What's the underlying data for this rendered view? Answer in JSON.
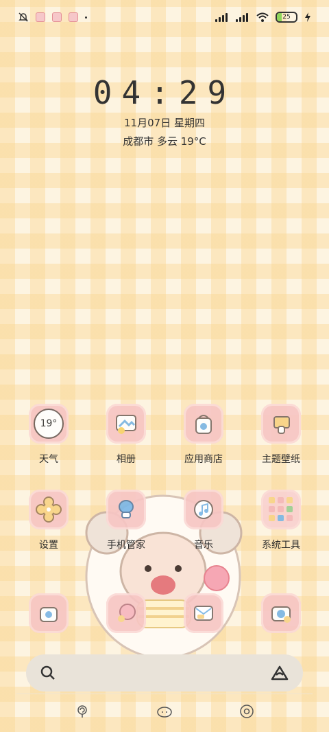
{
  "status": {
    "battery": "25",
    "battery_level_percent": 25,
    "icons": [
      "bell-off-icon",
      "notification-icon-1",
      "notification-icon-2",
      "notification-icon-3",
      "dot-icon",
      "signal-icon-1",
      "signal-icon-2",
      "wifi-icon",
      "battery-icon",
      "charging-icon"
    ]
  },
  "clock": {
    "time": "04:29",
    "date": "11月07日 星期四",
    "weather": "成都市 多云 19°C"
  },
  "apps": {
    "weather": {
      "label": "天气",
      "icon_text": "19°"
    },
    "album": {
      "label": "相册"
    },
    "store": {
      "label": "应用商店"
    },
    "themes": {
      "label": "主题壁纸"
    },
    "settings": {
      "label": "设置"
    },
    "phone_manager": {
      "label": "手机管家"
    },
    "music": {
      "label": "音乐"
    },
    "system_tools": {
      "label": "系统工具"
    }
  },
  "dock_icons": [
    "lollipop-icon",
    "cloud-face-icon",
    "donut-icon"
  ],
  "search": {
    "left_icon": "search-icon",
    "right_icon": "assistant-icon"
  },
  "colors": {
    "accent_pink": "#f7c6c4",
    "check_yellow": "#fad796",
    "text": "#2b2b2b"
  }
}
